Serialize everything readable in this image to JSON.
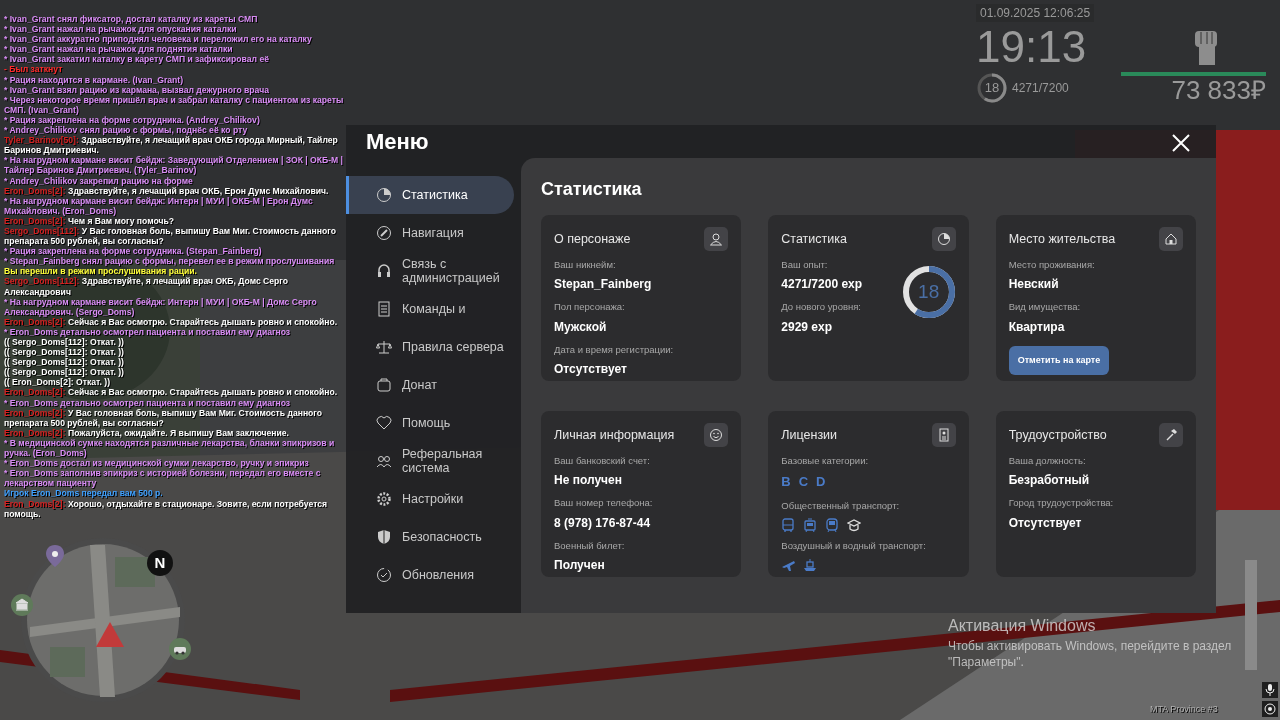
{
  "chat": [
    {
      "kind": "action",
      "text": "* Ivan_Grant снял фиксатор, достал каталку из кареты СМП"
    },
    {
      "kind": "action",
      "text": "* Ivan_Grant нажал на рычажок для опускания каталки"
    },
    {
      "kind": "action",
      "text": "* Ivan_Grant аккуратно приподнял человека и переложил его на каталку"
    },
    {
      "kind": "action",
      "text": "* Ivan_Grant нажал на рычажок для поднятия каталки"
    },
    {
      "kind": "action",
      "text": "* Ivan_Grant закатил каталку в карету СМП и зафиксировал её"
    },
    {
      "kind": "system",
      "text": "- Был заткнут"
    },
    {
      "kind": "action",
      "text": "* Рация находится в кармане. (Ivan_Grant)"
    },
    {
      "kind": "action",
      "text": "* Ivan_Grant взял рацию из кармана, вызвал дежурного врача"
    },
    {
      "kind": "action",
      "text": "* Через некоторое время пришёл врач и забрал каталку с пациентом из кареты СМП. (Ivan_Grant)"
    },
    {
      "kind": "action",
      "text": "* Рация закреплена на форме сотрудника. (Andrey_Chilikov)"
    },
    {
      "kind": "action",
      "text": "* Andrey_Chilikov снял рацию с формы, поднёс её ко рту"
    },
    {
      "kind": "speech",
      "name": "Tyler_Barinov[50]:",
      "text": "Здравствуйте, я лечащий врач ОКБ города Мирный, Тайлер Баринов Дмитриевич."
    },
    {
      "kind": "action",
      "text": "* На нагрудном кармане висит бейдж: Заведующий Отделением | ЗОК | ОКБ-М | Тайлер Баринов Дмитриевич. (Tyler_Barinov)"
    },
    {
      "kind": "action",
      "text": "* Andrey_Chilikov закрепил рацию на форме"
    },
    {
      "kind": "speech",
      "name": "Eron_Doms[2]:",
      "text": "Здравствуйте, я лечащий врач ОКБ, Ерон Думс Михайлович."
    },
    {
      "kind": "action",
      "text": "* На нагрудном кармане висит бейдж: Интерн | МУИ | ОКБ-М | Ерон Думс Михайлович. (Eron_Doms)"
    },
    {
      "kind": "speech",
      "name": "Eron_Doms[2]:",
      "text": "Чем я Вам могу помочь?"
    },
    {
      "kind": "speech",
      "name": "Sergo_Doms[112]:",
      "text": "У Вас головная боль, выпишу Вам Миг. Стоимость данного препарата 500 рублей, вы согласны?"
    },
    {
      "kind": "action",
      "text": "* Рация закреплена на форме сотрудника. (Stepan_Fainberg)"
    },
    {
      "kind": "action",
      "text": "* Stepan_Fainberg снял рацию с формы, перевел ее в режим прослушивания"
    },
    {
      "kind": "notice",
      "text": "Вы перешли в режим прослушивания рации."
    },
    {
      "kind": "speech",
      "name": "Sergo_Doms[112]:",
      "text": "Здравствуйте, я лечащий врач ОКБ, Домс Серго Александрович"
    },
    {
      "kind": "action",
      "text": "* На нагрудном кармане висит бейдж: Интерн | МУИ | ОКБ-М | Домс Серго Александрович. (Sergo_Doms)"
    },
    {
      "kind": "speech",
      "name": "Eron_Doms[2]:",
      "text": "Сейчас я Вас осмотрю. Старайтесь дышать ровно и спокойно."
    },
    {
      "kind": "action",
      "text": "* Eron_Doms детально осмотрел пациента и поставил ему диагноз"
    },
    {
      "kind": "ooc",
      "text": "(( Sergo_Doms[112]: Откат. ))"
    },
    {
      "kind": "ooc",
      "text": "(( Sergo_Doms[112]: Откат. ))"
    },
    {
      "kind": "ooc",
      "text": "(( Sergo_Doms[112]: Откат. ))"
    },
    {
      "kind": "ooc",
      "text": "(( Sergo_Doms[112]: Откат. ))"
    },
    {
      "kind": "ooc",
      "text": "(( Eron_Doms[2]: Откат. ))"
    },
    {
      "kind": "speech",
      "name": "Eron_Doms[2]:",
      "text": "Сейчас я Вас осмотрю. Старайтесь дышать ровно и спокойно."
    },
    {
      "kind": "action",
      "text": "* Eron_Doms детально осмотрел пациента и поставил ему диагноз"
    },
    {
      "kind": "speech",
      "name": "Eron_Doms[2]:",
      "text": "У Вас головная боль, выпишу Вам Миг. Стоимость данного препарата 500 рублей, вы согласны?"
    },
    {
      "kind": "speech",
      "name": "Eron_Doms[2]:",
      "text": "Пожалуйста, ожидайте. Я выпишу Вам заключение."
    },
    {
      "kind": "action",
      "text": "* В медицинской сумке находятся различные лекарства, бланки эпикризов и ручка. (Eron_Doms)"
    },
    {
      "kind": "action",
      "text": "* Eron_Doms достал из медицинской сумки лекарство, ручку и эпикриз"
    },
    {
      "kind": "action",
      "text": "* Eron_Doms заполнив эпикриз с историей болезни, передал его вместе с лекарством пациенту"
    },
    {
      "kind": "money",
      "text": "Игрок Eron_Doms передал вам 500 р."
    },
    {
      "kind": "speech",
      "name": "Eron_Doms[2]:",
      "text": "Хорошо, отдыхайте в стационаре. Зовите, если потребуется помощь."
    }
  ],
  "hud": {
    "date": "01.09.2025 12:06:25",
    "clock": "19:13",
    "player_level": "18",
    "exp": "4271/7200",
    "exp_ring": {
      "level": 0.59
    },
    "health_bar": {
      "level": 1
    },
    "money": "73 833₽"
  },
  "minimap": {
    "compass": "N"
  },
  "menu": {
    "title": "Меню",
    "items": [
      {
        "label": "Статистика",
        "kind": "stats",
        "selected": true
      },
      {
        "label": "Навигация",
        "kind": "nav",
        "selected": false
      },
      {
        "label": "Связь с администрацией",
        "kind": "support",
        "selected": false
      },
      {
        "label": "Команды и",
        "kind": "commands",
        "selected": false
      },
      {
        "label": "Правила сервера",
        "kind": "rules",
        "selected": false
      },
      {
        "label": "Донат",
        "kind": "donate",
        "selected": false
      },
      {
        "label": "Помощь",
        "kind": "help",
        "selected": false
      },
      {
        "label": "Реферальная система",
        "kind": "referral",
        "selected": false
      },
      {
        "label": "Настройки",
        "kind": "settings",
        "selected": false
      },
      {
        "label": "Безопасность",
        "kind": "security",
        "selected": false
      },
      {
        "label": "Обновления",
        "kind": "updates",
        "selected": false
      }
    ]
  },
  "page": {
    "title": "Статистика",
    "cards": [
      {
        "kind": "profile",
        "title": "О персонаже",
        "fields": [
          {
            "kind": "field",
            "label": "Ваш никнейм:",
            "value": "Stepan_Fainberg"
          },
          {
            "kind": "field",
            "label": "Пол персонажа:",
            "value": "Мужской"
          },
          {
            "kind": "field",
            "label": "Дата и время регистрации:",
            "value": "Отсутствует"
          }
        ]
      },
      {
        "kind": "stats",
        "title": "Статистика",
        "ring": {
          "value": "18",
          "level": 0.59
        },
        "fields": [
          {
            "kind": "field",
            "label": "Ваш опыт:",
            "value": "4271/7200 exp"
          },
          {
            "kind": "field",
            "label": "До нового уровня:",
            "value": "2929 exp"
          }
        ]
      },
      {
        "kind": "home",
        "title": "Место жительства",
        "fields": [
          {
            "kind": "field",
            "label": "Место проживания:",
            "value": "Невский"
          },
          {
            "kind": "field",
            "label": "Вид имущества:",
            "value": "Квартира"
          },
          {
            "kind": "button",
            "label": "Отметить на карте"
          }
        ]
      },
      {
        "kind": "personal",
        "title": "Личная информация",
        "fields": [
          {
            "kind": "field",
            "label": "Ваш банковский счет:",
            "value": "Не получен"
          },
          {
            "kind": "field",
            "label": "Ваш номер телефона:",
            "value": "8 (978) 176-87-44"
          },
          {
            "kind": "field",
            "label": "Военный билет:",
            "value": "Получен"
          }
        ]
      },
      {
        "kind": "licenses",
        "title": "Лицензии",
        "fields": [
          {
            "kind": "categories",
            "label": "Базовые категории:",
            "values": [
              "B",
              "C",
              "D"
            ]
          },
          {
            "kind": "ground_transport",
            "label": "Общественный транспорт:"
          },
          {
            "kind": "air_water_transport",
            "label": "Воздушный и водный транспорт:"
          }
        ]
      },
      {
        "kind": "job",
        "title": "Трудоустройство",
        "fields": [
          {
            "kind": "field",
            "label": "Ваша должность:",
            "value": "Безработный"
          },
          {
            "kind": "field",
            "label": "Город трудоустройства:",
            "value": "Отсутствует"
          }
        ]
      }
    ]
  },
  "windows_activation": {
    "title": "Активация Windows",
    "text": "Чтобы активировать Windows, перейдите в раздел \"Параметры\"."
  },
  "build_info": "MTA Province #3"
}
